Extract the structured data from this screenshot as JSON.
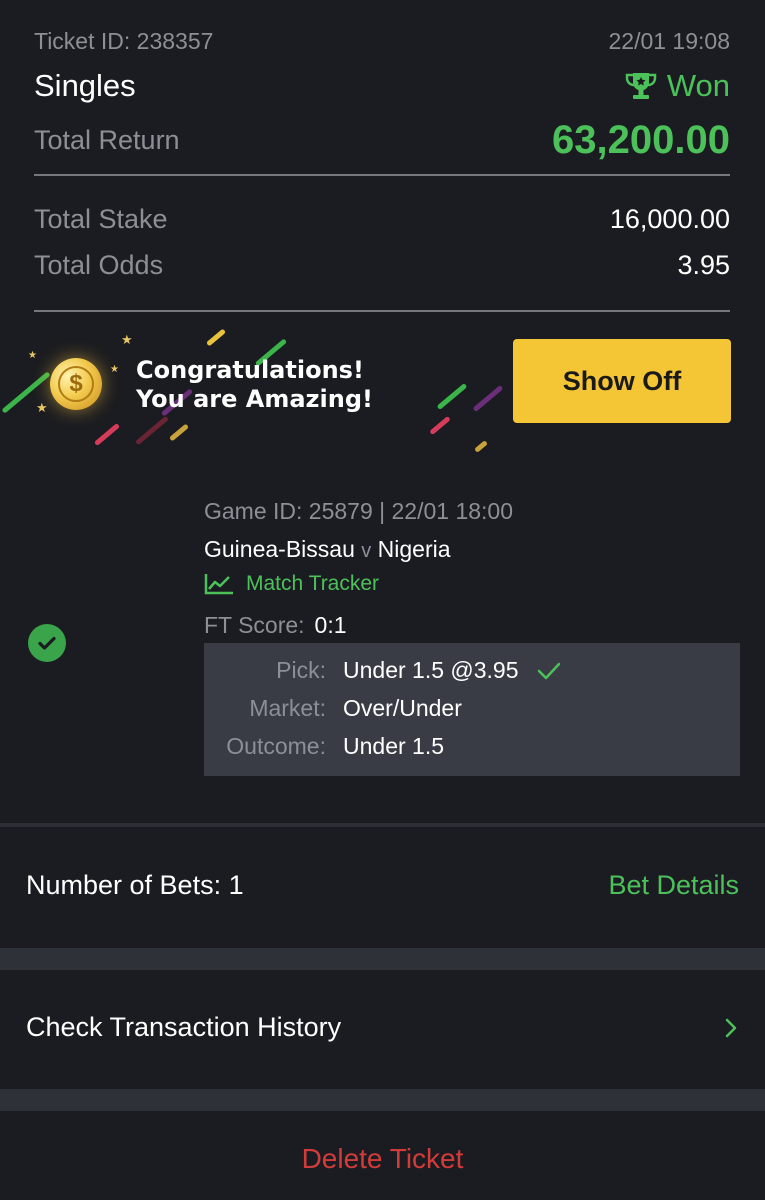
{
  "ticket": {
    "id_text": "Ticket ID: 238357",
    "datetime": "22/01 19:08",
    "type": "Singles",
    "status": "Won",
    "total_return_label": "Total Return",
    "total_return_value": "63,200.00",
    "total_stake_label": "Total Stake",
    "total_stake_value": "16,000.00",
    "total_odds_label": "Total Odds",
    "total_odds_value": "3.95"
  },
  "banner": {
    "line1": "Congratulations!",
    "line2": "You are Amazing!",
    "button_label": "Show Off"
  },
  "bet": {
    "game_info": "Game ID: 25879 | 22/01 18:00",
    "home": "Guinea-Bissau",
    "vs": "v",
    "away": "Nigeria",
    "tracker_label": "Match Tracker",
    "ft_label": "FT Score:",
    "ft_value": "0:1",
    "pick_label": "Pick:",
    "pick_value": "Under 1.5 @3.95",
    "market_label": "Market:",
    "market_value": "Over/Under",
    "outcome_label": "Outcome:",
    "outcome_value": "Under 1.5"
  },
  "summary": {
    "bets_count": "Number of Bets: 1",
    "details_link": "Bet Details",
    "history_label": "Check Transaction History",
    "delete_label": "Delete Ticket"
  },
  "icons": {
    "trophy": "trophy-icon",
    "coin": "coin-icon",
    "success": "check-circle-icon",
    "tracker": "chart-line-icon",
    "pick_check": "check-icon",
    "chevron": "chevron-right-icon"
  },
  "colors": {
    "background": "#1b1c21",
    "accent_green": "#4cc15a",
    "button_yellow": "#f4c534",
    "danger_red": "#d33b3b",
    "muted_text": "#8d8f96",
    "pick_box": "#393c45"
  }
}
